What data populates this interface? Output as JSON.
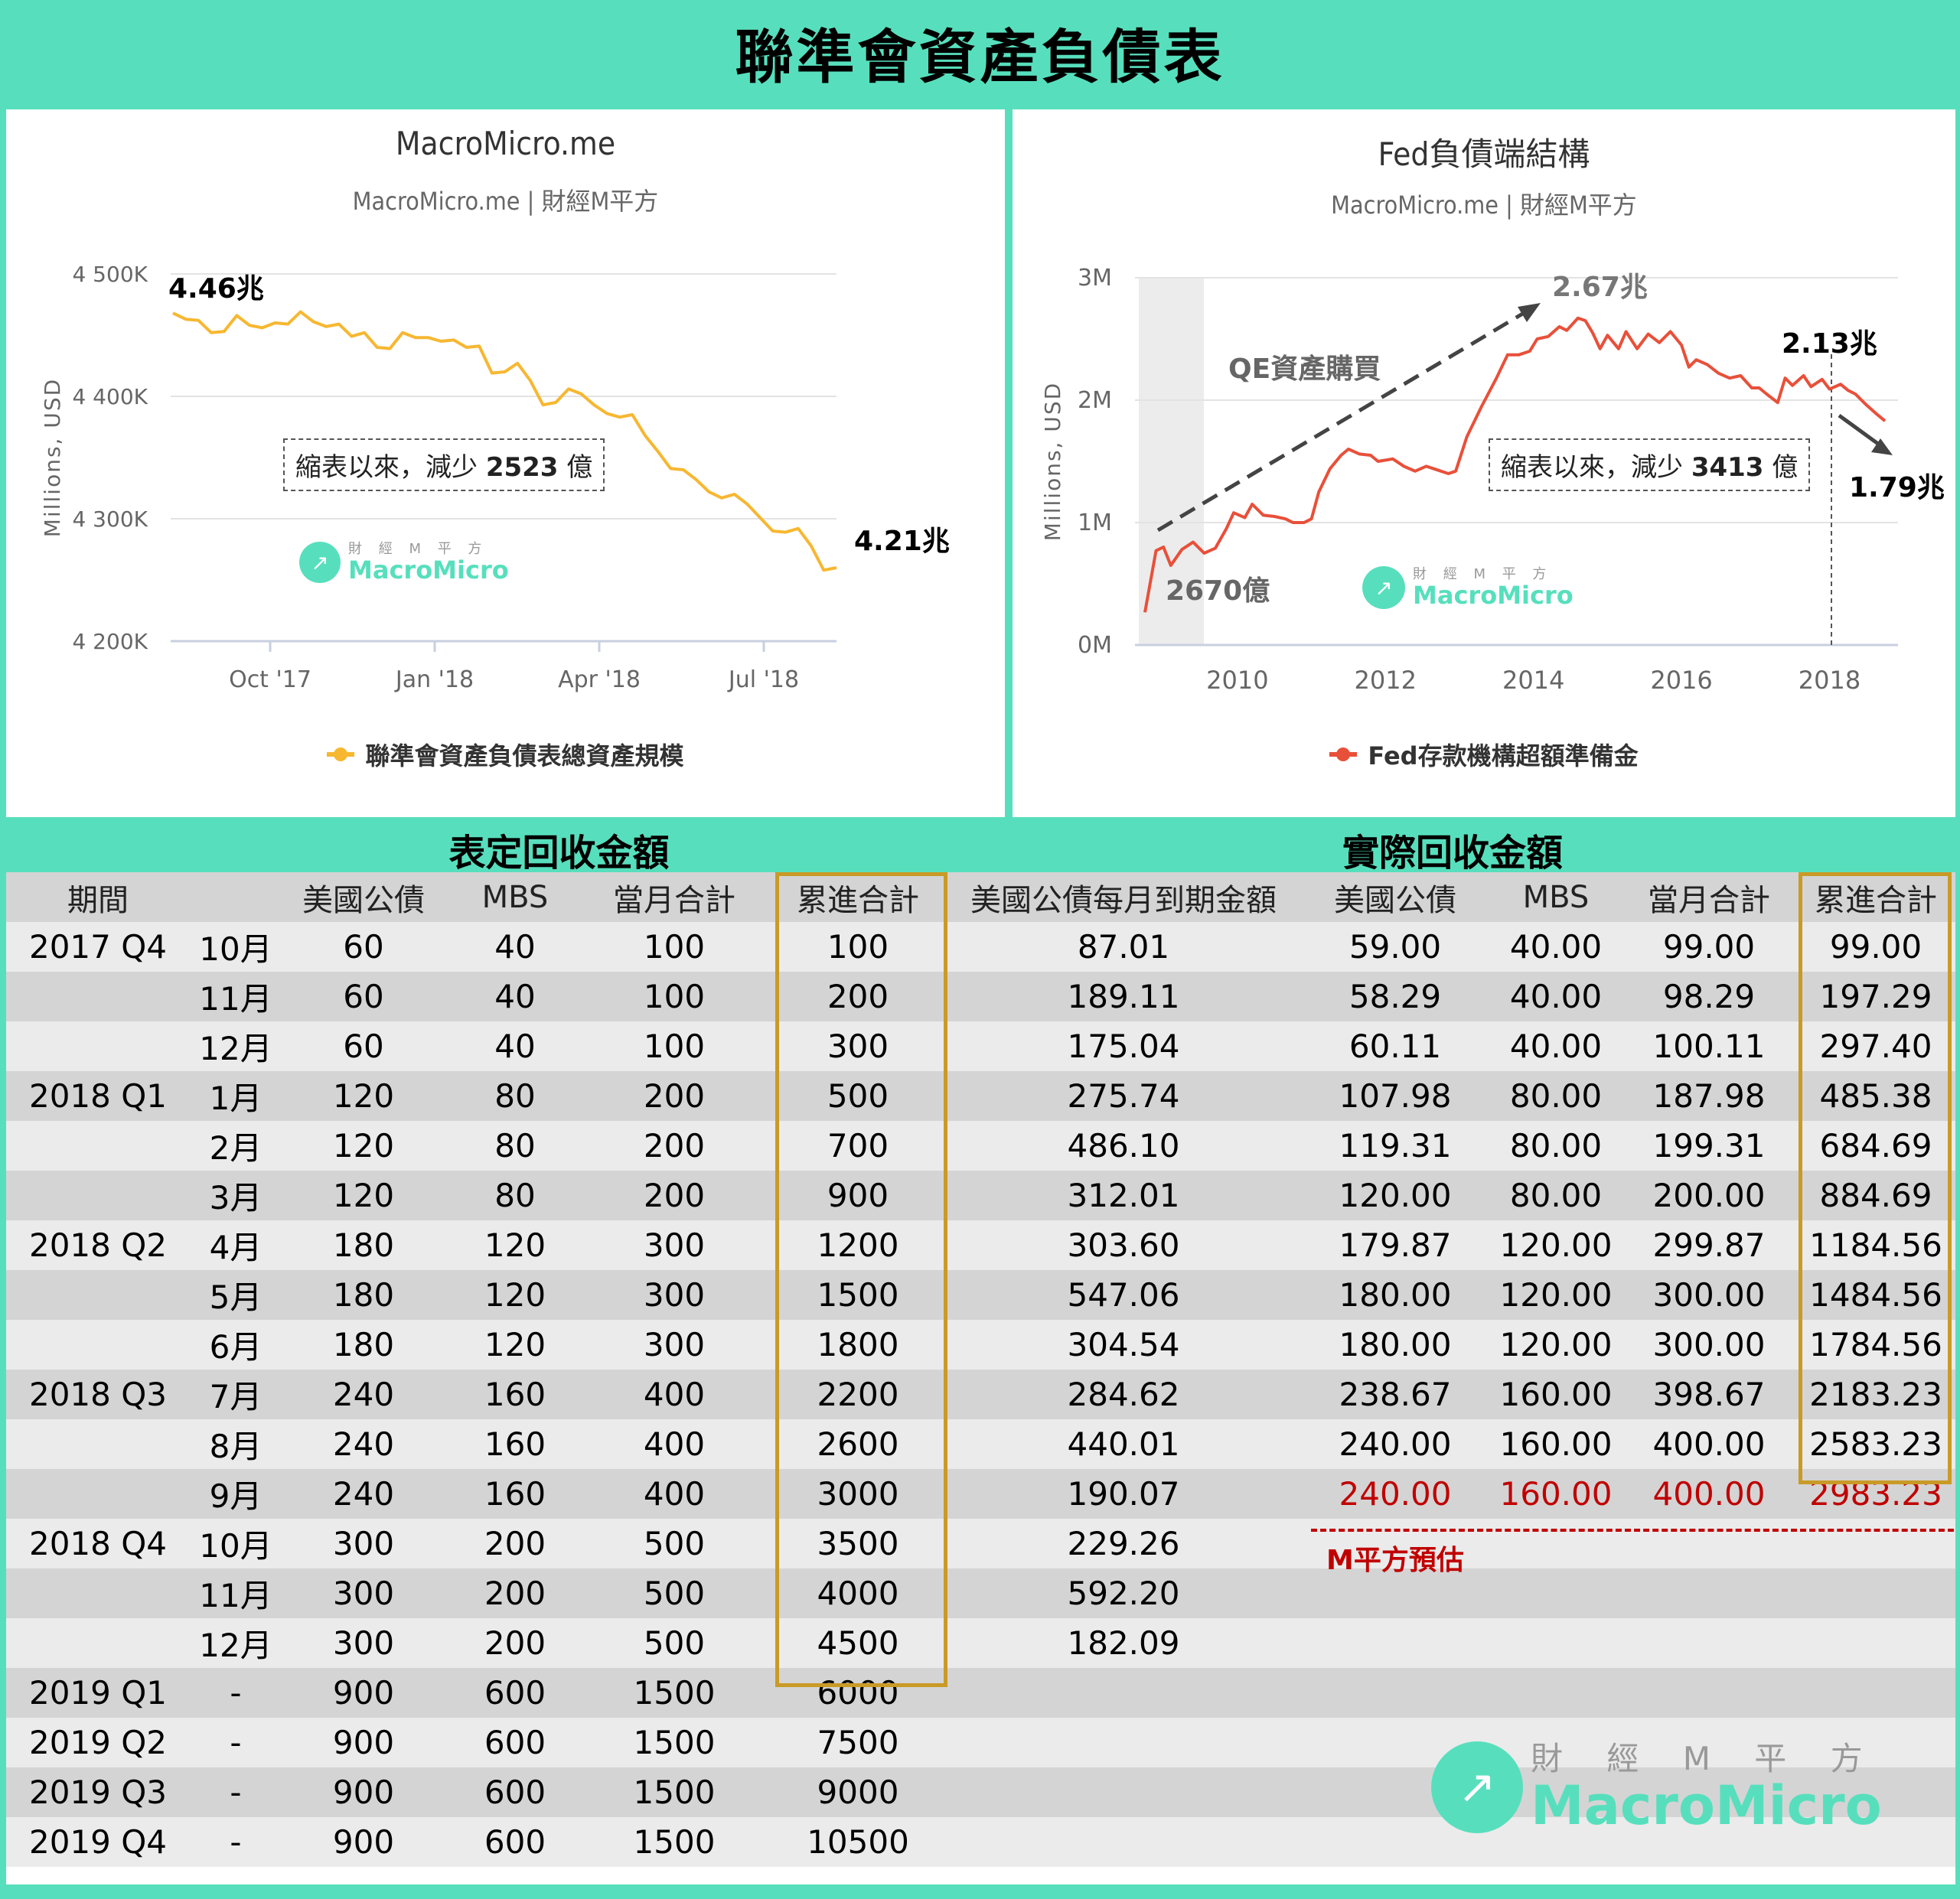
{
  "page_title": "聯準會資產負債表",
  "chart_data": [
    {
      "type": "line",
      "title": "MacroMicro.me",
      "subtitle": "MacroMicro.me | 財經M平方",
      "ylabel": "Millions, USD",
      "ylim": [
        4200000,
        4500000
      ],
      "y_ticks": [
        "4 200K",
        "4 300K",
        "4 400K",
        "4 500K"
      ],
      "x_ticks": [
        "Oct '17",
        "Jan '18",
        "Apr '18",
        "Jul '18"
      ],
      "series": [
        {
          "name": "聯準會資產負債表總資產規模",
          "color": "#f7b731",
          "values": [
            4468000,
            4463000,
            4462000,
            4452000,
            4453000,
            4466000,
            4458000,
            4456000,
            4460000,
            4459000,
            4469000,
            4461000,
            4457000,
            4459000,
            4449000,
            4452000,
            4440000,
            4439000,
            4452000,
            4448000,
            4448000,
            4445000,
            4446000,
            4440000,
            4441000,
            4419000,
            4420000,
            4427000,
            4413000,
            4393000,
            4395000,
            4406000,
            4402000,
            4393000,
            4386000,
            4383000,
            4385000,
            4368000,
            4355000,
            4341000,
            4340000,
            4332000,
            4322000,
            4317000,
            4320000,
            4312000,
            4301000,
            4290000,
            4289000,
            4292000,
            4278000,
            4258000,
            4260000
          ]
        }
      ],
      "annotations": {
        "start": "4.46兆",
        "end": "4.21兆",
        "box_prefix": "縮表以來，減少",
        "box_value": "2523",
        "box_suffix": "億"
      }
    },
    {
      "type": "line",
      "title": "Fed負債端結構",
      "subtitle": "MacroMicro.me | 財經M平方",
      "ylabel": "Millions, USD",
      "ylim": [
        0,
        3000000
      ],
      "y_ticks": [
        "0M",
        "1M",
        "2M",
        "3M"
      ],
      "x_ticks": [
        "2010",
        "2012",
        "2014",
        "2016",
        "2018"
      ],
      "x_range": [
        2008.7,
        2018.9
      ],
      "series": [
        {
          "name": "Fed存款機構超額準備金",
          "color": "#e8503a",
          "points": [
            [
              2008.75,
              267000
            ],
            [
              2008.9,
              770000
            ],
            [
              2009.0,
              800000
            ],
            [
              2009.1,
              650000
            ],
            [
              2009.25,
              780000
            ],
            [
              2009.4,
              840000
            ],
            [
              2009.55,
              750000
            ],
            [
              2009.7,
              790000
            ],
            [
              2009.85,
              950000
            ],
            [
              2009.95,
              1080000
            ],
            [
              2010.1,
              1040000
            ],
            [
              2010.2,
              1150000
            ],
            [
              2010.35,
              1060000
            ],
            [
              2010.5,
              1050000
            ],
            [
              2010.65,
              1030000
            ],
            [
              2010.75,
              1000000
            ],
            [
              2010.9,
              1000000
            ],
            [
              2011.0,
              1030000
            ],
            [
              2011.1,
              1250000
            ],
            [
              2011.25,
              1440000
            ],
            [
              2011.4,
              1550000
            ],
            [
              2011.5,
              1600000
            ],
            [
              2011.65,
              1560000
            ],
            [
              2011.8,
              1550000
            ],
            [
              2011.9,
              1500000
            ],
            [
              2012.1,
              1520000
            ],
            [
              2012.25,
              1460000
            ],
            [
              2012.4,
              1420000
            ],
            [
              2012.55,
              1460000
            ],
            [
              2012.7,
              1430000
            ],
            [
              2012.85,
              1400000
            ],
            [
              2012.95,
              1420000
            ],
            [
              2013.1,
              1700000
            ],
            [
              2013.3,
              1950000
            ],
            [
              2013.5,
              2180000
            ],
            [
              2013.65,
              2370000
            ],
            [
              2013.8,
              2370000
            ],
            [
              2013.95,
              2400000
            ],
            [
              2014.05,
              2500000
            ],
            [
              2014.2,
              2520000
            ],
            [
              2014.35,
              2600000
            ],
            [
              2014.45,
              2570000
            ],
            [
              2014.6,
              2670000
            ],
            [
              2014.7,
              2650000
            ],
            [
              2014.8,
              2550000
            ],
            [
              2014.9,
              2420000
            ],
            [
              2015.0,
              2530000
            ],
            [
              2015.15,
              2420000
            ],
            [
              2015.25,
              2560000
            ],
            [
              2015.4,
              2420000
            ],
            [
              2015.55,
              2540000
            ],
            [
              2015.7,
              2470000
            ],
            [
              2015.85,
              2560000
            ],
            [
              2016.0,
              2450000
            ],
            [
              2016.1,
              2270000
            ],
            [
              2016.2,
              2330000
            ],
            [
              2016.35,
              2290000
            ],
            [
              2016.5,
              2220000
            ],
            [
              2016.65,
              2180000
            ],
            [
              2016.8,
              2200000
            ],
            [
              2016.95,
              2100000
            ],
            [
              2017.05,
              2100000
            ],
            [
              2017.15,
              2050000
            ],
            [
              2017.3,
              1980000
            ],
            [
              2017.4,
              2180000
            ],
            [
              2017.5,
              2120000
            ],
            [
              2017.65,
              2200000
            ],
            [
              2017.75,
              2110000
            ],
            [
              2017.9,
              2170000
            ],
            [
              2018.0,
              2090000
            ],
            [
              2018.15,
              2130000
            ],
            [
              2018.25,
              2080000
            ],
            [
              2018.35,
              2050000
            ],
            [
              2018.5,
              1960000
            ],
            [
              2018.65,
              1880000
            ],
            [
              2018.75,
              1830000
            ]
          ]
        }
      ],
      "annotations": {
        "qe": "QE資產購買",
        "low": "2670億",
        "peak": "2.67兆",
        "pre": "2.13兆",
        "end": "1.79兆",
        "box_prefix": "縮表以來，減少",
        "box_value": "3413",
        "box_suffix": "億"
      }
    }
  ],
  "logo": {
    "top": "財 經 M 平 方",
    "name": "MacroMicro"
  },
  "table_left": {
    "title": "表定回收金額",
    "headers": [
      "期間",
      "",
      "美國公債",
      "MBS",
      "當月合計",
      "累進合計"
    ],
    "rows": [
      [
        "2017 Q4",
        "10月",
        "60",
        "40",
        "100",
        "100"
      ],
      [
        "",
        "11月",
        "60",
        "40",
        "100",
        "200"
      ],
      [
        "",
        "12月",
        "60",
        "40",
        "100",
        "300"
      ],
      [
        "2018 Q1",
        "1月",
        "120",
        "80",
        "200",
        "500"
      ],
      [
        "",
        "2月",
        "120",
        "80",
        "200",
        "700"
      ],
      [
        "",
        "3月",
        "120",
        "80",
        "200",
        "900"
      ],
      [
        "2018 Q2",
        "4月",
        "180",
        "120",
        "300",
        "1200"
      ],
      [
        "",
        "5月",
        "180",
        "120",
        "300",
        "1500"
      ],
      [
        "",
        "6月",
        "180",
        "120",
        "300",
        "1800"
      ],
      [
        "2018 Q3",
        "7月",
        "240",
        "160",
        "400",
        "2200"
      ],
      [
        "",
        "8月",
        "240",
        "160",
        "400",
        "2600"
      ],
      [
        "",
        "9月",
        "240",
        "160",
        "400",
        "3000"
      ],
      [
        "2018 Q4",
        "10月",
        "300",
        "200",
        "500",
        "3500"
      ],
      [
        "",
        "11月",
        "300",
        "200",
        "500",
        "4000"
      ],
      [
        "",
        "12月",
        "300",
        "200",
        "500",
        "4500"
      ],
      [
        "2019 Q1",
        "-",
        "900",
        "600",
        "1500",
        "6000"
      ],
      [
        "2019 Q2",
        "-",
        "900",
        "600",
        "1500",
        "7500"
      ],
      [
        "2019 Q3",
        "-",
        "900",
        "600",
        "1500",
        "9000"
      ],
      [
        "2019 Q4",
        "-",
        "900",
        "600",
        "1500",
        "10500"
      ]
    ]
  },
  "table_right": {
    "title": "實際回收金額",
    "headers": [
      "美國公債每月到期金額",
      "美國公債",
      "MBS",
      "當月合計",
      "累進合計"
    ],
    "rows": [
      [
        "87.01",
        "59.00",
        "40.00",
        "99.00",
        "99.00"
      ],
      [
        "189.11",
        "58.29",
        "40.00",
        "98.29",
        "197.29"
      ],
      [
        "175.04",
        "60.11",
        "40.00",
        "100.11",
        "297.40"
      ],
      [
        "275.74",
        "107.98",
        "80.00",
        "187.98",
        "485.38"
      ],
      [
        "486.10",
        "119.31",
        "80.00",
        "199.31",
        "684.69"
      ],
      [
        "312.01",
        "120.00",
        "80.00",
        "200.00",
        "884.69"
      ],
      [
        "303.60",
        "179.87",
        "120.00",
        "299.87",
        "1184.56"
      ],
      [
        "547.06",
        "180.00",
        "120.00",
        "300.00",
        "1484.56"
      ],
      [
        "304.54",
        "180.00",
        "120.00",
        "300.00",
        "1784.56"
      ],
      [
        "284.62",
        "238.67",
        "160.00",
        "398.67",
        "2183.23"
      ],
      [
        "440.01",
        "240.00",
        "160.00",
        "400.00",
        "2583.23"
      ],
      [
        "190.07",
        "240.00",
        "160.00",
        "400.00",
        "2983.23"
      ],
      [
        "229.26",
        "",
        "",
        "",
        ""
      ],
      [
        "592.20",
        "",
        "",
        "",
        ""
      ],
      [
        "182.09",
        "",
        "",
        "",
        ""
      ],
      [
        "",
        "",
        "",
        "",
        ""
      ],
      [
        "",
        "",
        "",
        "",
        ""
      ],
      [
        "",
        "",
        "",
        "",
        ""
      ],
      [
        "",
        "",
        "",
        "",
        ""
      ]
    ],
    "estimate_label": "M平方預估"
  }
}
